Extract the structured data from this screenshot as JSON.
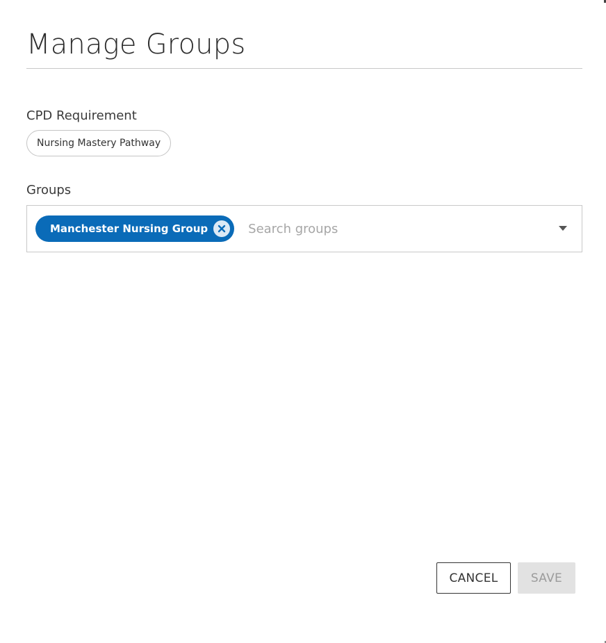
{
  "dialog": {
    "title": "Manage Groups"
  },
  "cpd_requirement": {
    "label": "CPD Requirement",
    "value": "Nursing Mastery Pathway"
  },
  "groups": {
    "label": "Groups",
    "selected": [
      {
        "label": "Manchester Nursing Group",
        "remove_icon": "close-circle-icon"
      }
    ],
    "search_placeholder": "Search groups",
    "search_value": "",
    "dropdown_icon": "caret-down-icon"
  },
  "actions": {
    "cancel_label": "CANCEL",
    "save_label": "SAVE",
    "save_enabled": false
  },
  "colors": {
    "chip_background": "#0a6bb8",
    "chip_remove_background": "#dce9f5",
    "disabled_button": "#e2e2e2"
  }
}
